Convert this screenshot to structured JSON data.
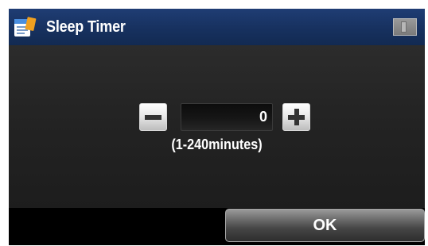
{
  "header": {
    "title": "Sleep Timer",
    "title_icon": "settings-document-icon",
    "status_icon": "memory-card-icon"
  },
  "timer": {
    "value": "0",
    "range_hint": "(1-240minutes)",
    "decrement_icon": "minus-icon",
    "increment_icon": "plus-icon"
  },
  "footer": {
    "ok_label": "OK"
  },
  "colors": {
    "header_blue": "#17315f",
    "panel_dark": "#242424",
    "text": "#ffffff"
  }
}
